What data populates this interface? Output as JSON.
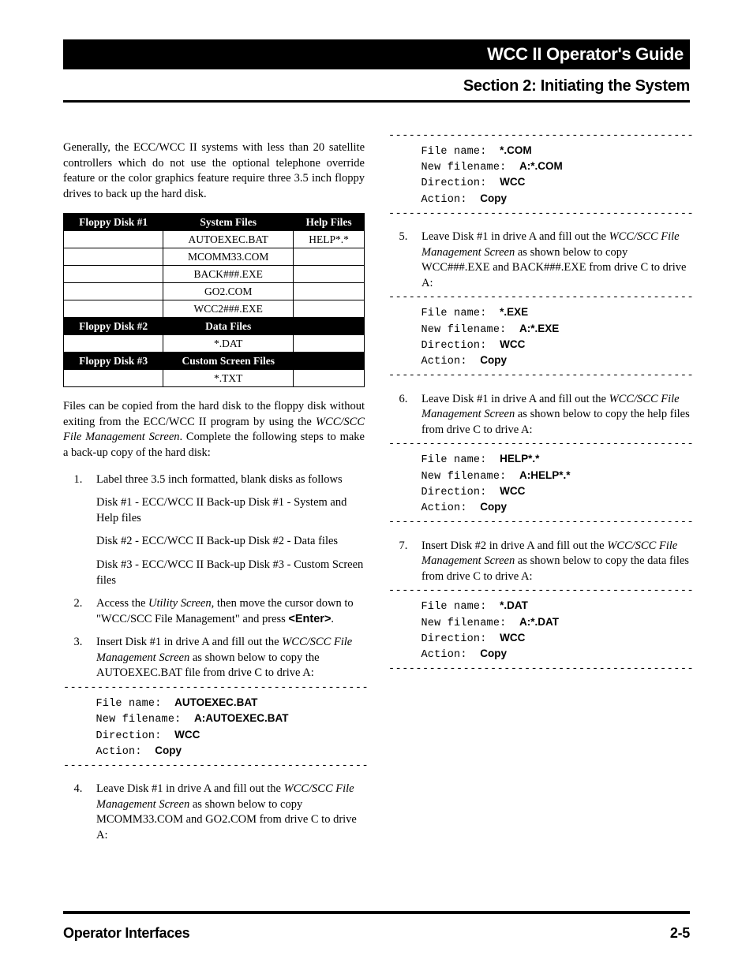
{
  "header": {
    "guide_title": "WCC II Operator's Guide",
    "section_title": "Section 2:  Initiating the System"
  },
  "intro": "Generally, the ECC/WCC II systems with less than 20 satellite controllers which do not use the optional telephone override feature or the color graphics feature require three 3.5 inch floppy drives to back up the hard disk.",
  "disk_table": {
    "rows": [
      {
        "type": "header",
        "c1": "Floppy Disk #1",
        "c2": "System Files",
        "c3": "Help Files"
      },
      {
        "type": "data",
        "c1": "",
        "c2": "AUTOEXEC.BAT",
        "c3": "HELP*.*"
      },
      {
        "type": "data",
        "c1": "",
        "c2": "MCOMM33.COM",
        "c3": ""
      },
      {
        "type": "data",
        "c1": "",
        "c2": "BACK###.EXE",
        "c3": ""
      },
      {
        "type": "data",
        "c1": "",
        "c2": "GO2.COM",
        "c3": ""
      },
      {
        "type": "data",
        "c1": "",
        "c2": "WCC2###.EXE",
        "c3": ""
      },
      {
        "type": "header",
        "c1": "Floppy Disk #2",
        "c2": "Data Files",
        "c3": ""
      },
      {
        "type": "data",
        "c1": "",
        "c2": "*.DAT",
        "c3": ""
      },
      {
        "type": "header",
        "c1": "Floppy Disk #3",
        "c2": "Custom Screen Files",
        "c3": ""
      },
      {
        "type": "data",
        "c1": "",
        "c2": "*.TXT",
        "c3": ""
      }
    ]
  },
  "after_table": {
    "p1a": "Files can be copied from the hard disk to the floppy disk without exiting from the ECC/WCC II program by using the ",
    "p1b": "WCC/SCC File Management Screen",
    "p1c": ". Complete the following steps to make a back-up copy of the hard disk:"
  },
  "steps_left": {
    "s1": {
      "lead": "Label three 3.5 inch formatted, blank disks as follows",
      "d1": "Disk #1 - ECC/WCC II Back-up Disk #1 - System and Help files",
      "d2": "Disk #2 - ECC/WCC II Back-up Disk #2 - Data files",
      "d3": "Disk #3 - ECC/WCC II Back-up Disk #3 - Custom Screen files"
    },
    "s2": {
      "a": "Access the ",
      "b": "Utility Screen",
      "c": ", then move the cursor down to \"WCC/SCC File Management\" and press ",
      "d": "<Enter>",
      "e": "."
    },
    "s3": {
      "a": "Insert Disk #1 in drive A and fill out the ",
      "b": "WCC/SCC File Management Screen",
      "c": " as shown below to copy the AUTOEXEC.BAT file from drive C to drive A:"
    },
    "s4": {
      "a": "Leave Disk #1 in drive A and fill out the ",
      "b": "WCC/SCC File Management Screen",
      "c": " as shown below to copy MCOMM33.COM and GO2.COM from drive C to drive A:"
    }
  },
  "steps_right": {
    "s5": {
      "a": "Leave Disk #1 in drive A and fill out the ",
      "b": "WCC/SCC File Management Screen",
      "c": " as shown below to copy WCC###.EXE and BACK###.EXE from drive C to drive A:"
    },
    "s6": {
      "a": "Leave Disk #1 in drive A and fill out the ",
      "b": "WCC/SCC File Management Screen",
      "c": " as shown below to copy the help files from drive C to drive A:"
    },
    "s7": {
      "a": "Insert Disk #2 in drive A and fill out the ",
      "b": "WCC/SCC File Management Screen",
      "c": " as shown below to copy the data files from drive C to drive A:"
    }
  },
  "screens": {
    "dashes": "---------------------------------------------",
    "labels": {
      "fn": "     File name:  ",
      "nfn": "     New filename:  ",
      "dir": "     Direction:  ",
      "act": "     Action:  "
    },
    "blk3": {
      "fn": "AUTOEXEC.BAT",
      "nfn": "A:AUTOEXEC.BAT",
      "dir": "WCC",
      "act": "Copy"
    },
    "blk4": {
      "fn": "*.COM",
      "nfn": "A:*.COM",
      "dir": "WCC",
      "act": "Copy"
    },
    "blk5": {
      "fn": "*.EXE",
      "nfn": "A:*.EXE",
      "dir": "WCC",
      "act": "Copy"
    },
    "blk6": {
      "fn": "HELP*.*",
      "nfn": "A:HELP*.*",
      "dir": "WCC",
      "act": "Copy"
    },
    "blk7": {
      "fn": "*.DAT",
      "nfn": "A:*.DAT",
      "dir": "WCC",
      "act": "Copy"
    }
  },
  "footer": {
    "left": "Operator Interfaces",
    "right": "2-5"
  }
}
